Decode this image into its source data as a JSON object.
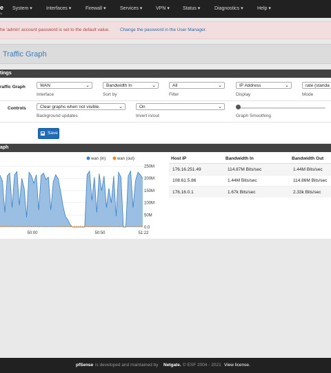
{
  "nav": {
    "logo_text": "e",
    "logo_sub": "N",
    "menu": [
      "System",
      "Interfaces",
      "Firewall",
      "Services",
      "VPN",
      "Status",
      "Diagnostics",
      "Help"
    ]
  },
  "alert": {
    "text": "he 'admin' account password is set to the default value.",
    "link": "Change the password in the User Manager."
  },
  "page_title": "Traffic Graph",
  "settings": {
    "header": "tings",
    "row1_label": "raffic Graph",
    "interface": {
      "value": "WAN",
      "hint": "Interface"
    },
    "sort_by": {
      "value": "Bandwidth In",
      "hint": "Sort by"
    },
    "filter": {
      "value": "All",
      "hint": "Filter"
    },
    "display": {
      "value": "IP Address",
      "hint": "Display"
    },
    "mode": {
      "value": "rate (standa",
      "hint": "Mode"
    },
    "row2_label": "Controls",
    "background": {
      "value": "Clear graphs when not visible.",
      "hint": "Background updates"
    },
    "invert": {
      "value": "On",
      "hint": "Invert in/out"
    },
    "smoothing": {
      "hint": "Graph Smoothing",
      "level": 0
    },
    "save_label": "Save"
  },
  "graph": {
    "header": "aph",
    "legend_in": "wan (in)",
    "legend_out": "wan (out)",
    "color_in": "#3b7fc4",
    "color_in_fill": "#8fb8df",
    "color_out": "#f08a24",
    "y_ticks": [
      "250M",
      "200M",
      "150M",
      "100M",
      "50M",
      "0.0"
    ],
    "x_ticks": [
      "50:00",
      "50:50",
      "51:22"
    ]
  },
  "chart_data": {
    "type": "area",
    "ylim": [
      0,
      260
    ],
    "ylabel": "",
    "xlabel": "",
    "series": [
      {
        "name": "wan (in)",
        "values": [
          213,
          190,
          60,
          210,
          222,
          80,
          215,
          228,
          90,
          200,
          160,
          40,
          225,
          210,
          180,
          215,
          70,
          212,
          222,
          195,
          205,
          70,
          185,
          215,
          200,
          150,
          90,
          45,
          30,
          10,
          0,
          0,
          0,
          0,
          0,
          0,
          215,
          230,
          110,
          205,
          60,
          220,
          150,
          210,
          80,
          160,
          100,
          210,
          45,
          225,
          205,
          0,
          0,
          210,
          230,
          80,
          190,
          225,
          215,
          200
        ]
      },
      {
        "name": "wan (out)",
        "values": [
          3,
          2,
          4,
          3,
          2,
          5,
          3,
          2,
          4,
          3,
          2,
          3,
          4,
          2,
          3,
          5,
          2,
          3,
          4,
          2,
          3,
          2,
          4,
          3,
          2,
          3,
          2,
          4,
          3,
          2,
          2,
          3,
          2,
          4,
          3,
          2,
          3,
          2,
          4,
          3,
          2,
          3,
          4,
          2,
          3,
          2,
          4,
          3,
          2,
          3,
          2,
          4,
          3,
          2,
          3,
          2,
          4,
          3,
          2,
          3
        ]
      }
    ]
  },
  "hosts": {
    "columns": [
      "Host IP",
      "Bandwidth In",
      "Bandwidth Out"
    ],
    "rows": [
      [
        "176.16.251.49",
        "114.87M Bits/sec",
        "1.44M Bits/sec"
      ],
      [
        "108.61.5.86",
        "1.44M Bits/sec",
        "114.86M Bits/sec"
      ],
      [
        "176.16.0.1",
        "1.67k Bits/sec",
        "2.33k Bits/sec"
      ]
    ]
  },
  "footer": {
    "brand": "pfSense",
    "text1": "is developed and maintained by",
    "company": "Netgate.",
    "text2": "© ESF 2004 - 2021",
    "license": "View license."
  }
}
